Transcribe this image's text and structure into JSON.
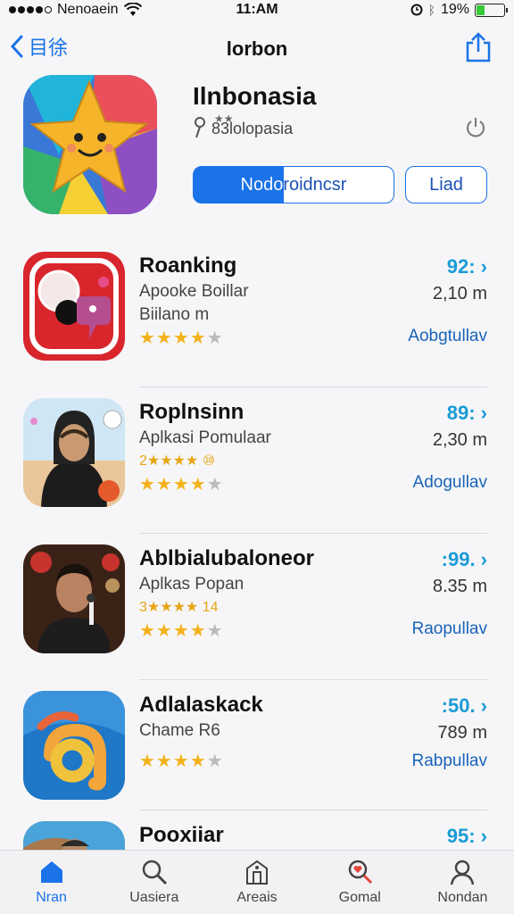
{
  "status_bar": {
    "carrier": "Nenoaein",
    "time": "11:AM",
    "battery": "19%"
  },
  "nav": {
    "back_label": "目徐",
    "title": "lorbon"
  },
  "header_app": {
    "name": "Ilnbonasia",
    "stars_line": "★★",
    "subtitle": "83lolopasia",
    "primary_button": "Nodoroidncsr",
    "secondary_button": "Liad",
    "progress": 0.45
  },
  "apps": [
    {
      "name": "Roanking",
      "category": "Apooke Boillar",
      "extra": "Biilano m",
      "rating_text": "",
      "stars": 4,
      "price": "92: ›",
      "size": "2,10 m",
      "action": "Aobgtullav"
    },
    {
      "name": "Roplnsinn",
      "category": "Aplkasi Pomulaar",
      "extra": "",
      "rating_text": "2★★★★ ⑩",
      "stars": 4,
      "price": "89: ›",
      "size": "2,30 m",
      "action": "Adogullav"
    },
    {
      "name": "Ablbialubaloneor",
      "category": "Aplkas Popan",
      "extra": "",
      "rating_text": "3★★★★ 14",
      "stars": 4,
      "price": ":99. ›",
      "size": "8.35 m",
      "action": "Raopullav"
    },
    {
      "name": "Adlalaskack",
      "category": "Chame R6",
      "extra": "",
      "rating_text": "",
      "stars": 4,
      "price": ":50. ›",
      "size": "789 m",
      "action": "Rabpullav"
    },
    {
      "name": "Pooxiiar",
      "category": "",
      "extra": "",
      "rating_text": "",
      "stars": 0,
      "price": "95: ›",
      "size": "",
      "action": ""
    }
  ],
  "tabs": [
    {
      "label": "Nran",
      "icon": "home-icon",
      "active": true
    },
    {
      "label": "Uasiera",
      "icon": "search-icon",
      "active": false
    },
    {
      "label": "Areais",
      "icon": "store-icon",
      "active": false
    },
    {
      "label": "Gomal",
      "icon": "magnifier-heart-icon",
      "active": false
    },
    {
      "label": "Nondan",
      "icon": "profile-icon",
      "active": false
    }
  ],
  "colors": {
    "accent": "#1a73e8",
    "price": "#1a9bd7",
    "star": "#f3b21b"
  }
}
